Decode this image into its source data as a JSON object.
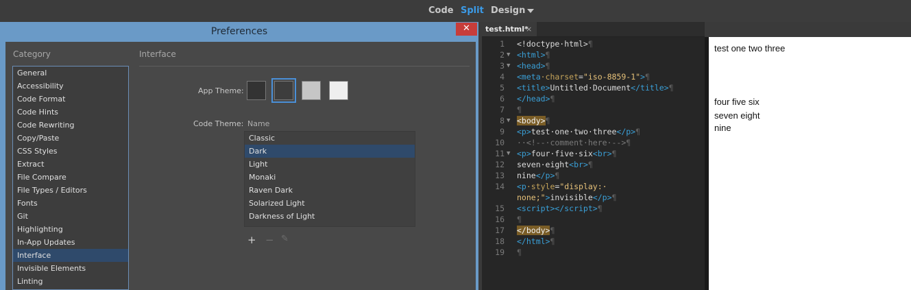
{
  "toolbar": {
    "modes": [
      "Code",
      "Split",
      "Design"
    ],
    "active_mode": "Split"
  },
  "dialog": {
    "title": "Preferences",
    "close_glyph": "✕",
    "category_label": "Category",
    "categories": [
      "General",
      "Accessibility",
      "Code Format",
      "Code Hints",
      "Code Rewriting",
      "Copy/Paste",
      "CSS Styles",
      "Extract",
      "File Compare",
      "File Types / Editors",
      "Fonts",
      "Git",
      "Highlighting",
      "In-App Updates",
      "Interface",
      "Invisible Elements",
      "Linting"
    ],
    "selected_category": "Interface",
    "section_title": "Interface",
    "app_theme_label": "App Theme:",
    "app_theme_swatches": [
      "#333333",
      "#3d3d3d",
      "#c6c6c6",
      "#efefef"
    ],
    "selected_app_theme": 1,
    "code_theme_label": "Code Theme:",
    "code_theme_header": "Name",
    "code_themes": [
      "Classic",
      "Dark",
      "Light",
      "Monaki",
      "Raven Dark",
      "Solarized Light",
      "Darkness of Light"
    ],
    "selected_code_theme": "Dark",
    "tools": {
      "add": "+",
      "remove": "−",
      "edit": "✎"
    }
  },
  "editor": {
    "tab_label": "test.html*",
    "tab_close": "×",
    "line_numbers": [
      "1",
      "2",
      "3",
      "4",
      "5",
      "6",
      "7",
      "8",
      "9",
      "10",
      "11",
      "12",
      "13",
      "14",
      "",
      "15",
      "16",
      "17",
      "18",
      "19"
    ]
  },
  "live_view": {
    "paragraphs": [
      "test one two three",
      "four five six",
      "seven eight",
      "nine"
    ]
  },
  "colors": {
    "accent": "#3b9be8",
    "dialog_frame": "#6a9ac7",
    "close_button": "#c73d3a",
    "selection": "#2f4a6b",
    "code_tag": "#3aa0d8",
    "code_string": "#e7c27a",
    "code_highlight": "#7a5d26"
  }
}
